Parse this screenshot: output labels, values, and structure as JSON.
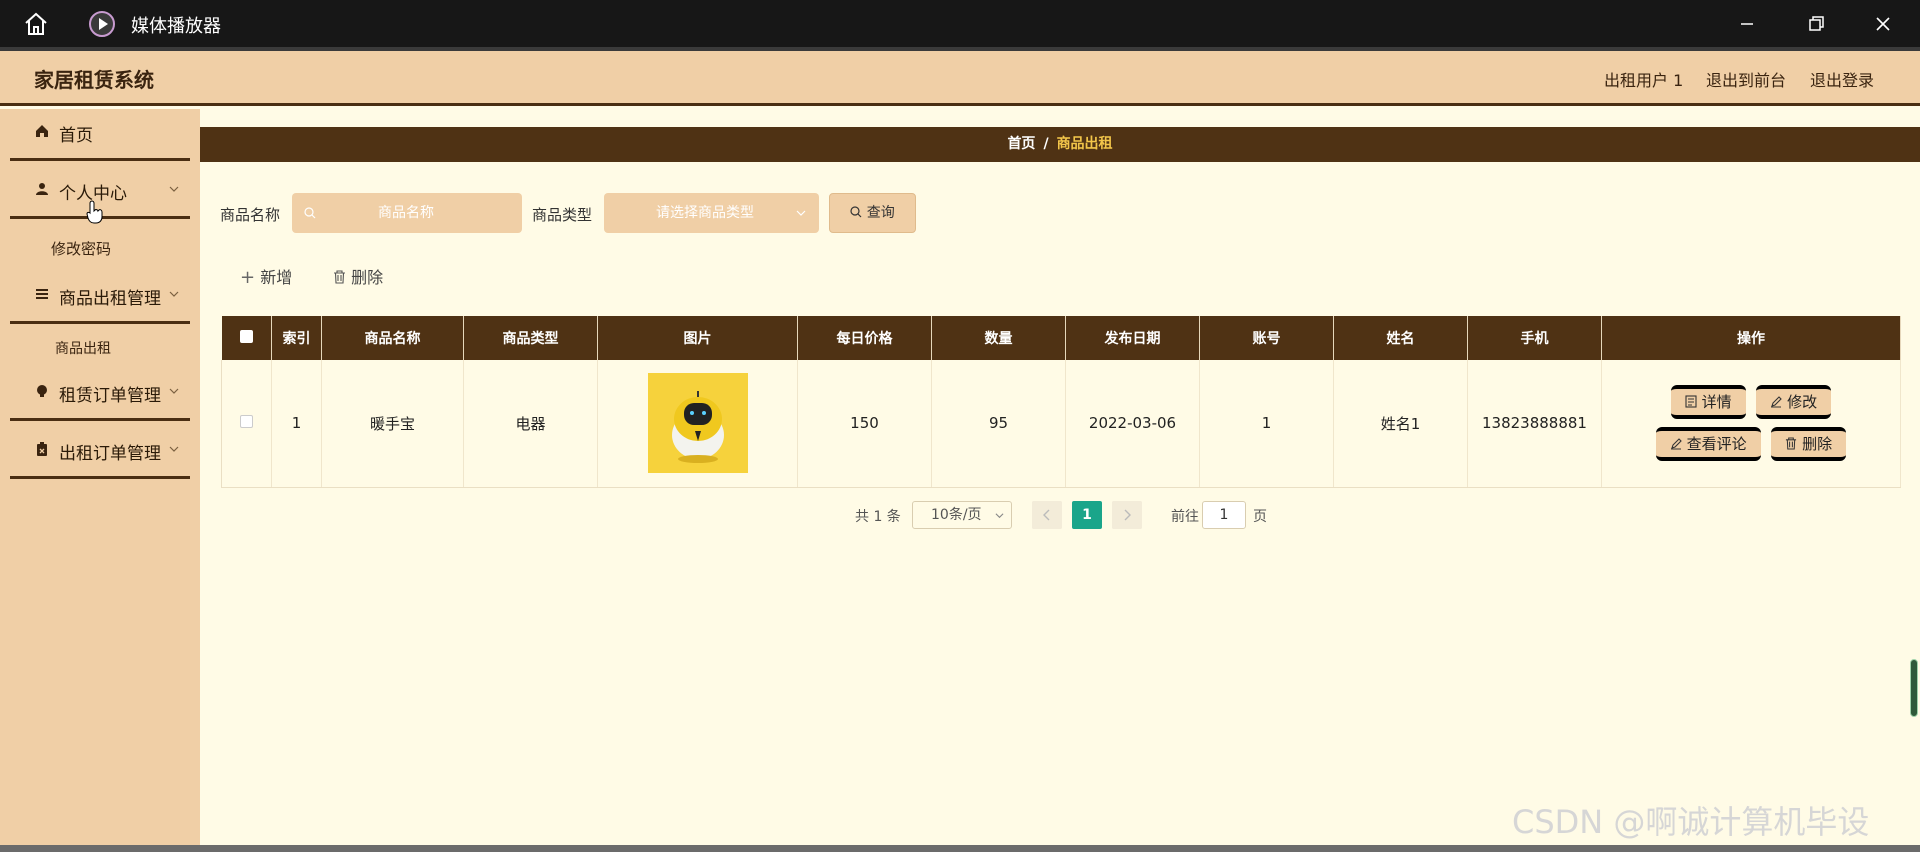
{
  "window": {
    "app_title": "媒体播放器"
  },
  "header": {
    "brand": "家居租赁系统",
    "user_label": "出租用户 1",
    "front_label": "退出到前台",
    "logout_label": "退出登录"
  },
  "sidebar": {
    "items": [
      {
        "label": "首页",
        "icon": "home-icon"
      },
      {
        "label": "个人中心",
        "icon": "user-icon",
        "children": [
          "修改密码"
        ]
      },
      {
        "label": "商品出租管理",
        "icon": "list-icon",
        "children": [
          "商品出租"
        ]
      },
      {
        "label": "租赁订单管理",
        "icon": "bulb-icon"
      },
      {
        "label": "出租订单管理",
        "icon": "clipboard-icon"
      }
    ]
  },
  "breadcrumb": {
    "home": "首页",
    "sep": "/",
    "current": "商品出租"
  },
  "search": {
    "name_label": "商品名称",
    "name_placeholder": "商品名称",
    "type_label": "商品类型",
    "type_placeholder": "请选择商品类型",
    "query_label": "查询"
  },
  "toolbar": {
    "add_label": "新增",
    "delete_label": "删除"
  },
  "table": {
    "columns": [
      "索引",
      "商品名称",
      "商品类型",
      "图片",
      "每日价格",
      "数量",
      "发布日期",
      "账号",
      "姓名",
      "手机",
      "操作"
    ],
    "rows": [
      {
        "index": "1",
        "name": "暖手宝",
        "type": "电器",
        "price": "150",
        "qty": "95",
        "date": "2022-03-06",
        "account": "1",
        "person": "姓名1",
        "phone": "13823888881"
      }
    ],
    "actions": {
      "detail": "详情",
      "edit": "修改",
      "review": "查看评论",
      "delete": "删除"
    }
  },
  "pagination": {
    "total": "共 1 条",
    "page_size": "10条/页",
    "current_page": "1",
    "goto_prefix": "前往",
    "goto_value": "1",
    "goto_suffix": "页"
  },
  "watermark": "CSDN @啊诚计算机毕设",
  "colors": {
    "brown": "#4f3214",
    "tan": "#f0cfa6",
    "cream": "#fffbe6",
    "accent_yellow": "#f3c64a",
    "page_green": "#1aa58a"
  }
}
